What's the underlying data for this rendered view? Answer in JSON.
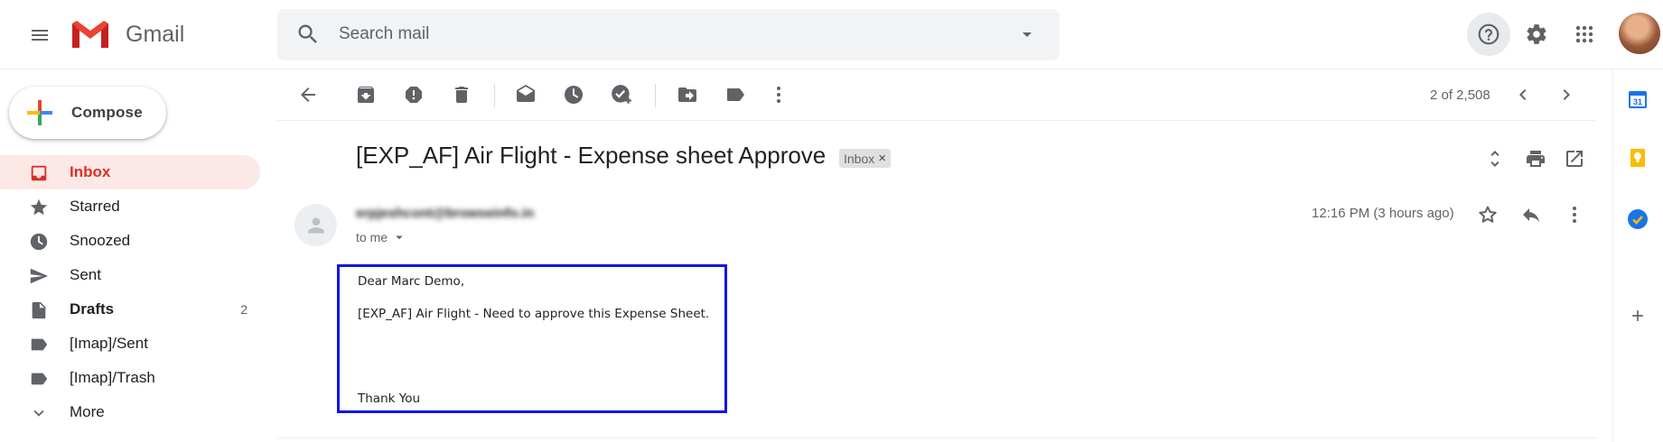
{
  "header": {
    "app_name": "Gmail",
    "search_placeholder": "Search mail"
  },
  "sidebar": {
    "compose_label": "Compose",
    "items": [
      {
        "label": "Inbox",
        "count": ""
      },
      {
        "label": "Starred",
        "count": ""
      },
      {
        "label": "Snoozed",
        "count": ""
      },
      {
        "label": "Sent",
        "count": ""
      },
      {
        "label": "Drafts",
        "count": "2"
      },
      {
        "label": "[Imap]/Sent",
        "count": ""
      },
      {
        "label": "[Imap]/Trash",
        "count": ""
      },
      {
        "label": "More",
        "count": ""
      }
    ]
  },
  "toolbar": {
    "pagination": "2 of 2,508"
  },
  "message": {
    "subject": "[EXP_AF] Air Flight - Expense sheet Approve",
    "label_chip": "Inbox",
    "label_chip_close": "×",
    "sender": "erpjeshcont@browseinfo.in",
    "recipient": "to me",
    "timestamp": "12:16 PM (3 hours ago)",
    "body": {
      "greeting": "Dear Marc Demo,",
      "line1": "[EXP_AF] Air Flight - Need to approve this Expense Sheet.",
      "closing": "Thank You"
    }
  },
  "side_panel": {
    "calendar_icon_text": "31"
  },
  "colors": {
    "accent_red": "#d93025",
    "active_bg": "#fce8e6",
    "highlight_box": "#1414e6",
    "icon_gray": "#5f6368"
  }
}
